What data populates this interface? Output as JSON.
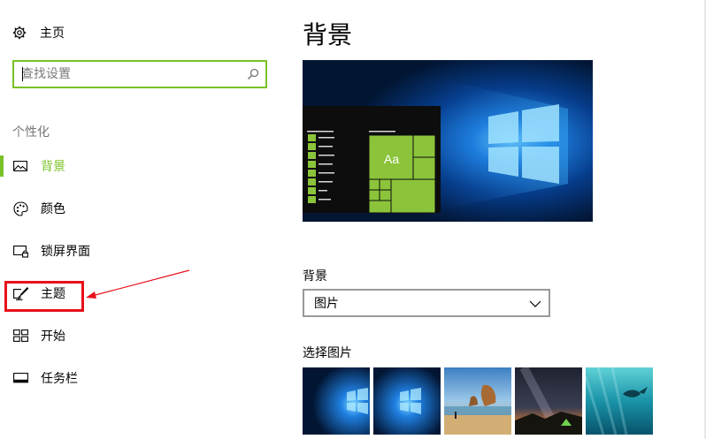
{
  "sidebar": {
    "home_label": "主页",
    "search": {
      "placeholder": "查找设置"
    },
    "group_title": "个性化",
    "items": [
      {
        "label": "背景",
        "icon": "picture-icon",
        "selected": true
      },
      {
        "label": "颜色",
        "icon": "palette-icon",
        "selected": false
      },
      {
        "label": "锁屏界面",
        "icon": "lock-screen-icon",
        "selected": false
      },
      {
        "label": "主题",
        "icon": "theme-icon",
        "selected": false
      },
      {
        "label": "开始",
        "icon": "start-icon",
        "selected": false
      },
      {
        "label": "任务栏",
        "icon": "taskbar-icon",
        "selected": false
      }
    ]
  },
  "main": {
    "title": "背景",
    "preview": {
      "tile_label": "Aa"
    },
    "background_label": "背景",
    "background_value": "图片",
    "choose_picture_label": "选择图片",
    "thumbnails": [
      "windows-hero-1",
      "windows-hero-2",
      "beach-rocks",
      "night-sky-tent",
      "underwater-swimmer"
    ]
  },
  "colors": {
    "accent": "#7ac127",
    "annotation": "#e8101a"
  }
}
